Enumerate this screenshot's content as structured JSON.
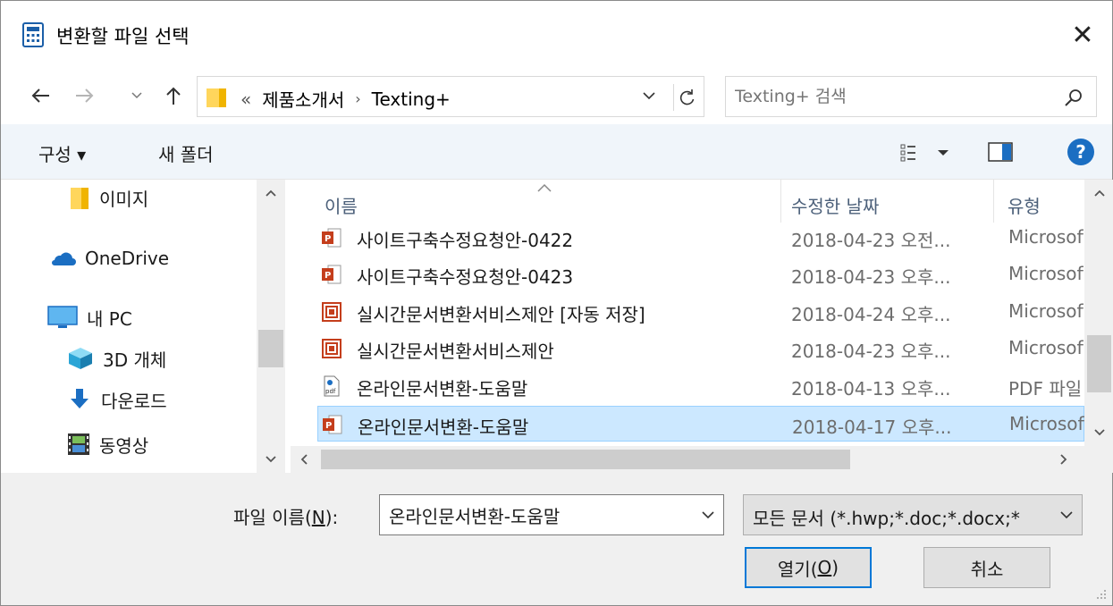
{
  "window": {
    "title": "변환할 파일 선택",
    "close_label": "✕",
    "app_icon": "calculator-icon"
  },
  "nav": {
    "back_icon": "back-arrow-icon",
    "forward_icon": "forward-arrow-icon",
    "recent_icon": "chevron-down-icon",
    "up_icon": "up-arrow-icon",
    "address": {
      "overflow": "«",
      "crumbs": [
        "제품소개서",
        "Texting+"
      ],
      "separator": "›"
    },
    "search_placeholder": "Texting+ 검색"
  },
  "toolbar": {
    "organize": "구성 ▾",
    "new_folder": "새 폴더",
    "help": "?"
  },
  "left_nav": {
    "items": [
      {
        "label": "이미지",
        "icon": "folder-icon"
      },
      {
        "label": "OneDrive",
        "icon": "cloud-icon"
      },
      {
        "label": "내 PC",
        "icon": "monitor-icon"
      },
      {
        "label": "3D 개체",
        "icon": "cube-icon"
      },
      {
        "label": "다운로드",
        "icon": "download-arrow-icon"
      },
      {
        "label": "동영상",
        "icon": "film-icon"
      }
    ]
  },
  "file_list": {
    "columns": {
      "name": "이름",
      "date": "수정한 날짜",
      "type": "유형"
    },
    "rows": [
      {
        "name": "사이트구축수정요청안-0422",
        "date": "2018-04-23 오전...",
        "type": "Microsoft",
        "icon": "powerpoint-icon"
      },
      {
        "name": "사이트구축수정요청안-0423",
        "date": "2018-04-23 오후...",
        "type": "Microsoft",
        "icon": "powerpoint-icon"
      },
      {
        "name": "실시간문서변환서비스제안 [자동 저장]",
        "date": "2018-04-24 오후...",
        "type": "Microsoft",
        "icon": "powerpoint-show-icon"
      },
      {
        "name": "실시간문서변환서비스제안",
        "date": "2018-04-23 오후...",
        "type": "Microsoft",
        "icon": "powerpoint-show-icon"
      },
      {
        "name": "온라인문서변환-도움말",
        "date": "2018-04-13 오후...",
        "type": "PDF 파일",
        "icon": "pdf-file-icon"
      },
      {
        "name": "온라인문서변환-도움말",
        "date": "2018-04-17 오후...",
        "type": "Microsoft",
        "icon": "powerpoint-icon",
        "selected": true
      }
    ]
  },
  "bottom": {
    "filename_label_pre": "파일 이름(",
    "filename_label_key": "N",
    "filename_label_post": "):",
    "filename_value": "온라인문서변환-도움말",
    "filetype_value": "모든 문서 (*.hwp;*.doc;*.docx;*",
    "open_label_pre": "열기(",
    "open_label_key": "O",
    "open_label_post": ")",
    "cancel_label": "취소"
  },
  "colors": {
    "selection_bg": "#cce8ff",
    "selection_border": "#99d1ff",
    "accent": "#0078d7",
    "header_text": "#4c607a"
  }
}
